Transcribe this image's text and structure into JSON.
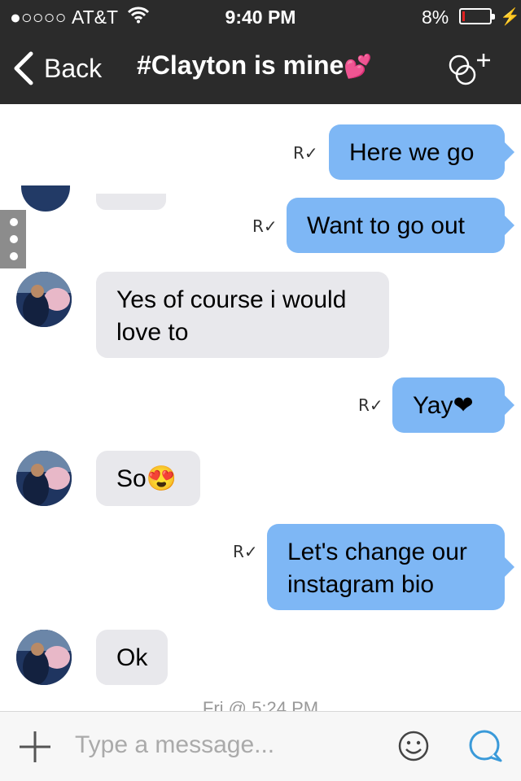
{
  "status_bar": {
    "signal": "●○○○○",
    "carrier": "AT&T",
    "time": "9:40 PM",
    "battery": "8%",
    "battery_level": 0.08,
    "wifi_icon": "wifi-icon",
    "charging_icon": "bolt-icon"
  },
  "nav": {
    "back_label": "Back",
    "title": "#Clayton is mine",
    "title_emoji": "💕",
    "add_people_icon": "add-participant-icon"
  },
  "messages": [
    {
      "direction": "out",
      "lines": [
        "Here we go"
      ],
      "read_mark": "R✓"
    },
    {
      "direction": "out",
      "lines": [
        "Want to go out"
      ],
      "read_mark": "R✓"
    },
    {
      "direction": "in",
      "lines": [
        "Yes of course i would",
        "love to"
      ]
    },
    {
      "direction": "out",
      "lines": [
        "Yay❤"
      ],
      "read_mark": "R✓"
    },
    {
      "direction": "in",
      "lines": [
        "So😍"
      ]
    },
    {
      "direction": "out",
      "lines": [
        "Let's change our",
        "instagram bio"
      ],
      "read_mark": "R✓"
    },
    {
      "direction": "in",
      "lines": [
        "Ok"
      ]
    }
  ],
  "timestamp": "Fri @ 5:24 PM",
  "composer": {
    "placeholder": "Type a message...",
    "add_icon": "plus-icon",
    "emoji_icon": "smiley-icon",
    "send_icon": "chat-bubble-icon"
  },
  "colors": {
    "outgoing_bubble": "#7eb7f5",
    "incoming_bubble": "#e8e8ec",
    "top_bar": "#2b2b2b",
    "send_icon": "#3a9ad9"
  }
}
